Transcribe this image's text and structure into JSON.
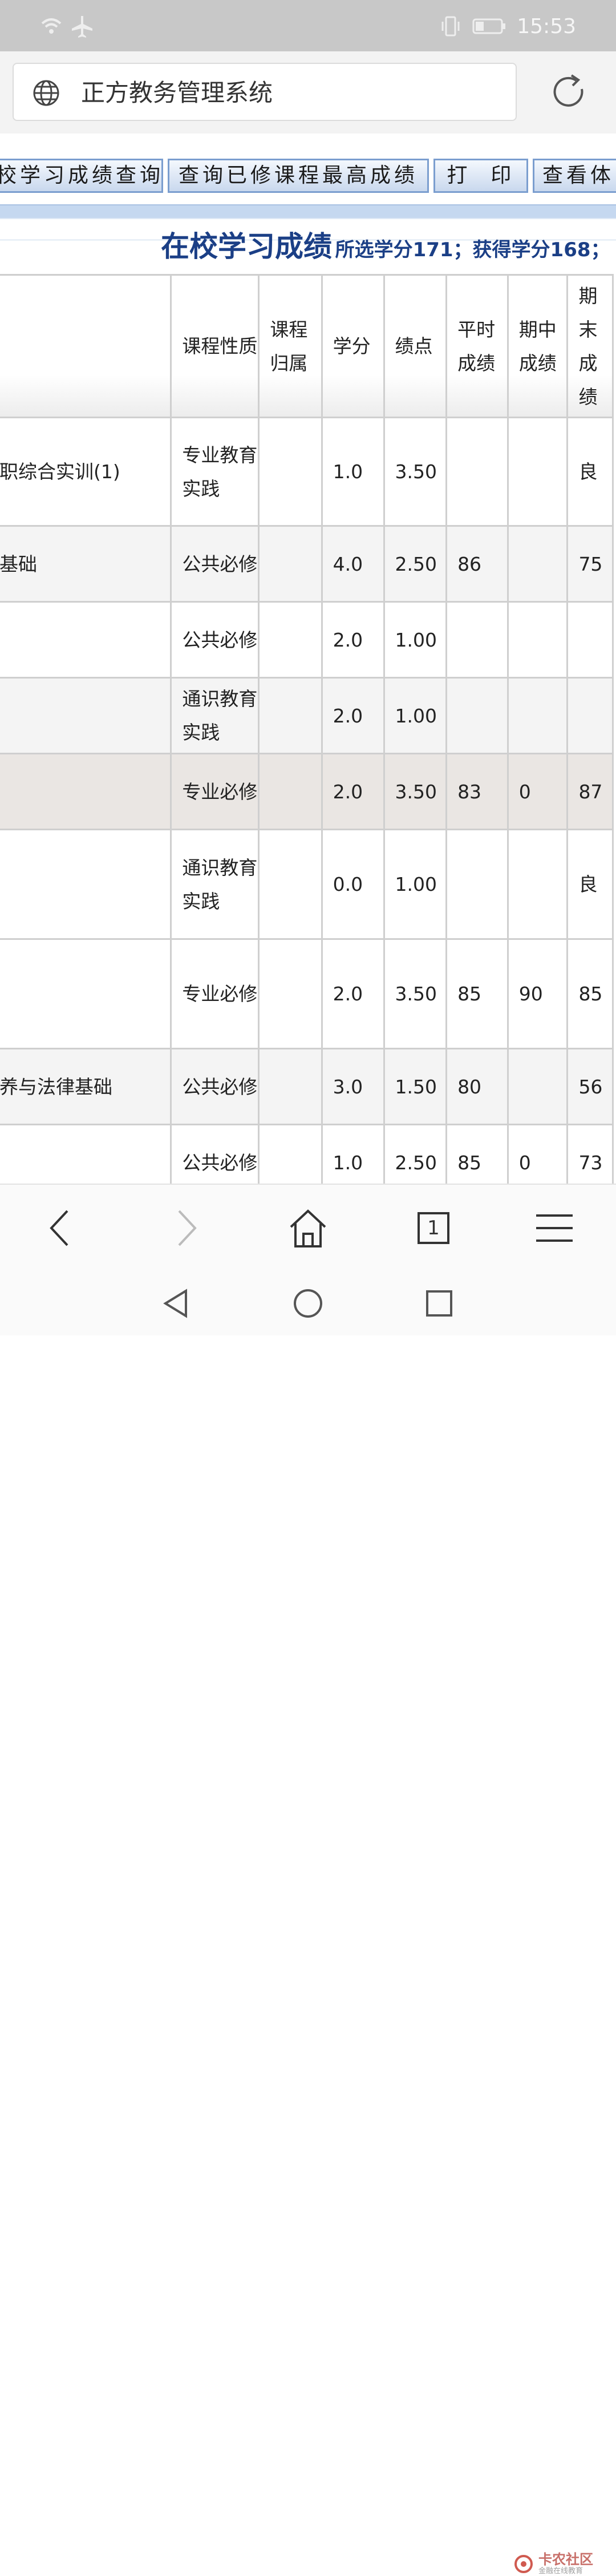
{
  "status_bar": {
    "time": "15:53",
    "icons": [
      "wifi-icon",
      "airplane-icon",
      "vibrate-icon",
      "battery-icon"
    ]
  },
  "browser": {
    "page_title": "正方教务管理系统"
  },
  "toolbar": {
    "buttons": [
      "校学习成绩查询",
      "查询已修课程最高成绩",
      "打  印",
      "查看体"
    ]
  },
  "page_heading": {
    "title": "在校学习成绩",
    "summary": "所选学分171；获得学分168；"
  },
  "table": {
    "headers": [
      "",
      "课程性质",
      "课程归属",
      "学分",
      "绩点",
      "平时成绩",
      "期中成绩",
      "期末成绩"
    ],
    "rows": [
      {
        "course": "职综合实训(1)",
        "type": "专业教育实践",
        "belong": "",
        "credit": "1.0",
        "gpa": "3.50",
        "usual": "",
        "mid": "",
        "final": "良"
      },
      {
        "course": "基础",
        "type": "公共必修",
        "belong": "",
        "credit": "4.0",
        "gpa": "2.50",
        "usual": "86",
        "mid": "",
        "final": "75"
      },
      {
        "course": "",
        "type": "公共必修",
        "belong": "",
        "credit": "2.0",
        "gpa": "1.00",
        "usual": "",
        "mid": "",
        "final": ""
      },
      {
        "course": "",
        "type": "通识教育实践",
        "belong": "",
        "credit": "2.0",
        "gpa": "1.00",
        "usual": "",
        "mid": "",
        "final": ""
      },
      {
        "course": "",
        "type": "专业必修",
        "belong": "",
        "credit": "2.0",
        "gpa": "3.50",
        "usual": "83",
        "mid": "0",
        "final": "87"
      },
      {
        "course": "",
        "type": "通识教育实践",
        "belong": "",
        "credit": "0.0",
        "gpa": "1.00",
        "usual": "",
        "mid": "",
        "final": "良"
      },
      {
        "course": "",
        "type": "专业必修",
        "belong": "",
        "credit": "2.0",
        "gpa": "3.50",
        "usual": "85",
        "mid": "90",
        "final": "85"
      },
      {
        "course": "养与法律基础",
        "type": "公共必修",
        "belong": "",
        "credit": "3.0",
        "gpa": "1.50",
        "usual": "80",
        "mid": "",
        "final": "56"
      },
      {
        "course": "",
        "type": "公共必修",
        "belong": "",
        "credit": "1.0",
        "gpa": "2.50",
        "usual": "85",
        "mid": "0",
        "final": "73"
      }
    ]
  },
  "bottom_nav": {
    "tab_count": "1"
  },
  "watermark": {
    "title": "卡农社区",
    "subtitle": "金融在线教育"
  },
  "colors": {
    "heading_blue": "#1b3f86",
    "button_border": "#7b9ecf",
    "status_bar": "#c8c8c8"
  }
}
